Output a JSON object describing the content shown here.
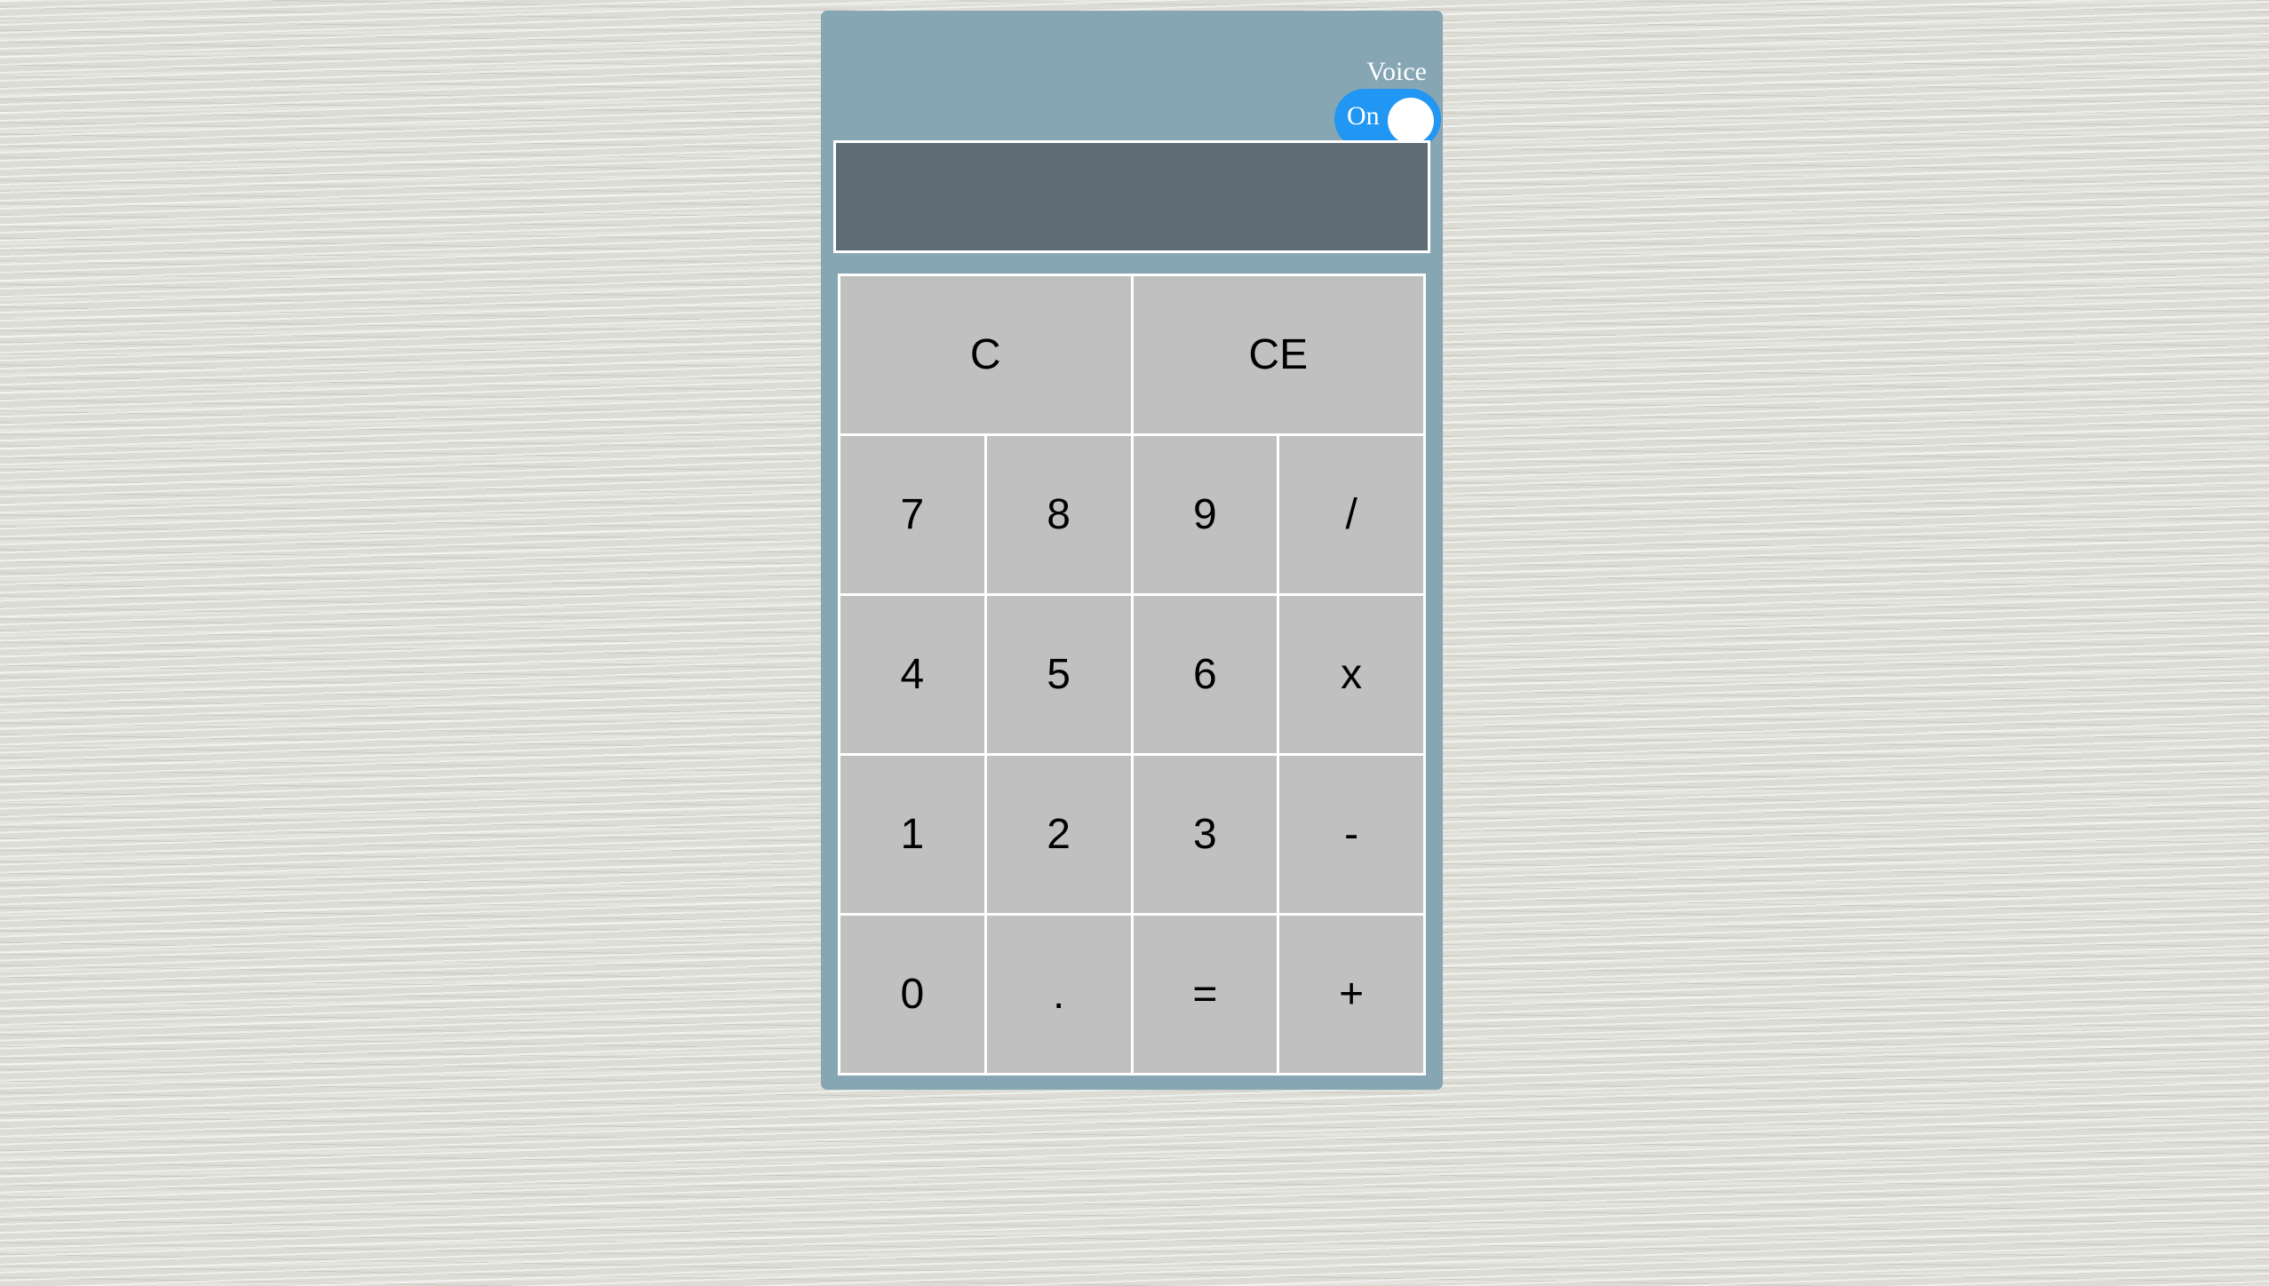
{
  "voice": {
    "label": "Voice",
    "toggle_text": "On",
    "state": "on",
    "color": "#2196f3"
  },
  "display": {
    "value": ""
  },
  "keys": {
    "clear": "C",
    "clear_entry": "CE",
    "seven": "7",
    "eight": "8",
    "nine": "9",
    "divide": "/",
    "four": "4",
    "five": "5",
    "six": "6",
    "multiply": "x",
    "one": "1",
    "two": "2",
    "three": "3",
    "subtract": "-",
    "zero": "0",
    "decimal": ".",
    "equals": "=",
    "add": "+"
  },
  "colors": {
    "panel": "#87a6b4",
    "display": "#5f6c76",
    "key": "#c0c0c0"
  }
}
